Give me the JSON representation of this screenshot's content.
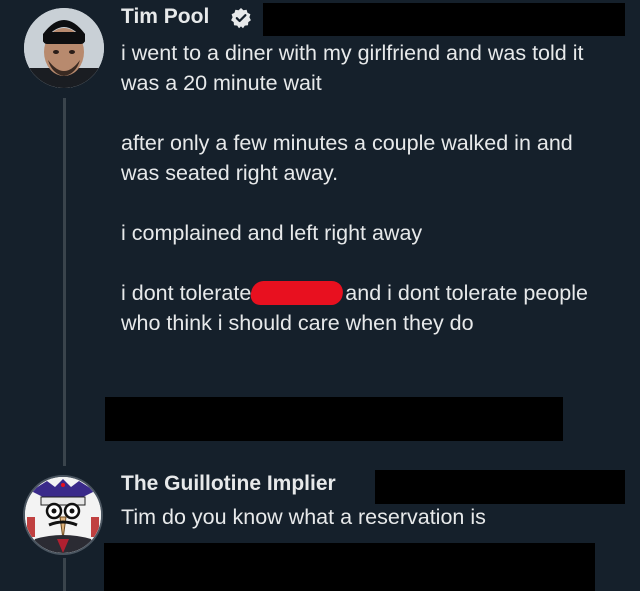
{
  "tweet": {
    "author": "Tim Pool",
    "paragraphs": [
      "i went to a diner with my girlfriend and was told it was a 20 minute wait",
      "after only a few minutes a couple walked in and was seated right away.",
      "i complained and left right away"
    ],
    "last_before": "i dont tolerate",
    "last_after": "and i dont tolerate people who think i should care when they do"
  },
  "reply": {
    "author": "The Guillotine Implier",
    "text": "Tim do you know what a reservation is"
  },
  "icons": {
    "verified": "verified-badge-icon",
    "redaction": "red-scribble-redaction"
  },
  "colors": {
    "background": "#15202b",
    "text": "#e7e9ea",
    "redaction_red": "#e8101f",
    "redaction_black": "#000000"
  }
}
